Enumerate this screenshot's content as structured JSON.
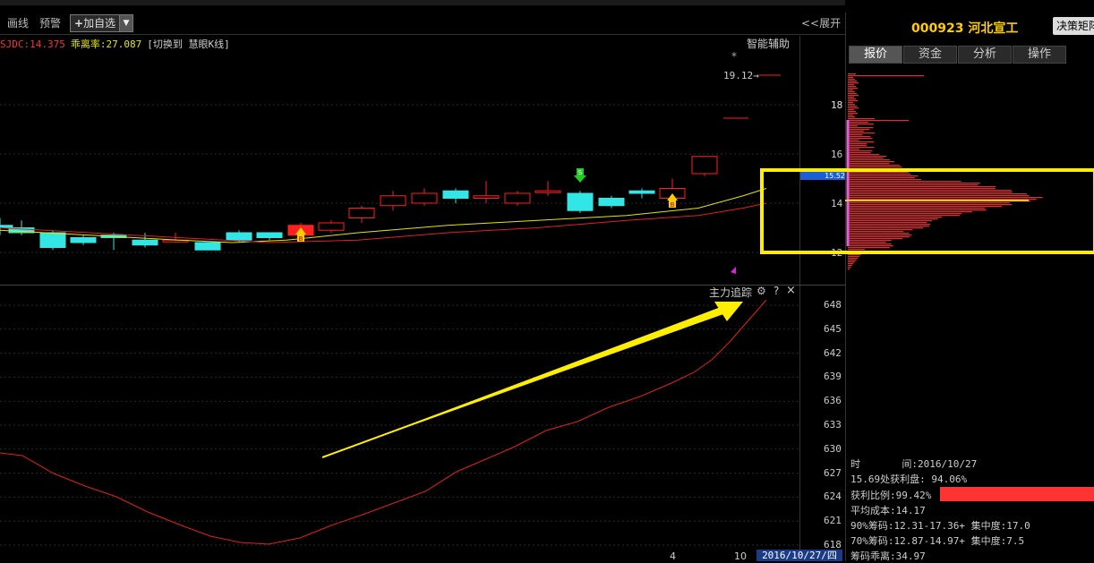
{
  "toolbar": {
    "draw_line": "画线",
    "alert": "预警",
    "add_watch": "加自选",
    "expand": "<<展开"
  },
  "main_chart": {
    "sjdc": "SJDC:14.375",
    "ratio": "乖离率:27.087",
    "switch": "[切换到 慧眼K线]",
    "smart": "智能辅助",
    "star": "*",
    "high_label": "19.12→",
    "y_ticks": [
      "18",
      "16",
      "14",
      "12"
    ],
    "current_price_box": "15.52",
    "colors": {
      "up": "#ff2020",
      "down": "#33e6e6",
      "ma_yellow": "#e6e600",
      "ma_red": "#e02020"
    }
  },
  "sub_chart": {
    "title": "主力追踪",
    "help": "?",
    "close": "×",
    "y_ticks": [
      "648",
      "645",
      "642",
      "639",
      "636",
      "633",
      "630",
      "627",
      "624",
      "621",
      "618"
    ]
  },
  "x_axis": {
    "labels": [
      "4",
      "10"
    ],
    "current_date": "2016/10/27/四"
  },
  "right_panel": {
    "code": "000923",
    "name": "河北宣工",
    "decision_button": "决策矩阵",
    "tabs": [
      "报价",
      "资金",
      "分析",
      "操作"
    ],
    "time_label": "时",
    "time_value": "间:2016/10/27",
    "profit_line": "15.69处获利盘: 94.06%",
    "profit_ratio": "获利比例:99.42%",
    "avg_cost": "平均成本:14.17",
    "chip90": "90%筹码:12.31-17.36+ 集中度:17.0",
    "chip70": "70%筹码:12.87-14.97+ 集中度:7.5",
    "chip_dev": "筹码乖离:34.97",
    "y_ticks": [
      "18",
      "16",
      "14"
    ]
  }
}
